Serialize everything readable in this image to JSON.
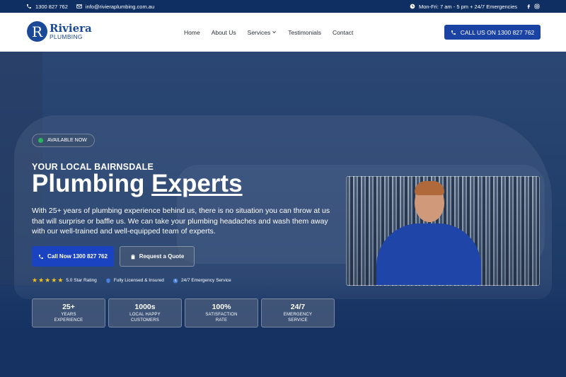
{
  "topbar": {
    "phone": "1300 827 762",
    "email": "info@rivieraplumbing.com.au",
    "hours": "Mon-Fri: 7 am - 5 pm + 24/7 Emergencies"
  },
  "logo": {
    "line1": "Riviera",
    "line2": "PLUMBING",
    "mark": "R"
  },
  "nav": {
    "home": "Home",
    "about": "About Us",
    "services": "Services",
    "testimonials": "Testimonials",
    "contact": "Contact"
  },
  "header": {
    "call_label": "CALL US ON 1300 827 762"
  },
  "hero": {
    "badge": "AVAILABLE NOW",
    "kicker": "YOUR LOCAL BAIRNSDALE",
    "headline_part1": "Plumbing ",
    "headline_part2": "Experts",
    "description": "With 25+ years of plumbing experience behind us, there is no situation you can throw at us that will surprise or baffle us. We can take your plumbing headaches and wash them away with our well-trained and well-equipped team of experts.",
    "call_button": "Call Now 1300 827 762",
    "quote_button": "Request a Quote",
    "rating_text": "5.0 Star Rating",
    "licensed_text": "Fully Licensed & Insured",
    "emergency_text": "24/7 Emergency Service",
    "star_count": 5
  },
  "stats": [
    {
      "value": "25+",
      "line1": "YEARS",
      "line2": "EXPERIENCE"
    },
    {
      "value": "1000s",
      "line1": "LOCAL HAPPY",
      "line2": "CUSTOMERS"
    },
    {
      "value": "100%",
      "line1": "SATISFACTION",
      "line2": "RATE"
    },
    {
      "value": "24/7",
      "line1": "EMERGENCY",
      "line2": "SERVICE"
    }
  ],
  "colors": {
    "brand_blue": "#1a4a97",
    "button_blue": "#1a43c2",
    "topbar_bg": "#0f2f62",
    "star_yellow": "#f5c21a",
    "available_green": "#29b35c"
  },
  "icons": {
    "phone": "phone-icon",
    "email": "envelope-icon",
    "clock": "clock-icon",
    "facebook": "facebook-icon",
    "instagram": "instagram-icon",
    "chevron": "chevron-down-icon",
    "shield": "shield-icon",
    "clipboard": "clipboard-icon",
    "emergency": "clock-icon"
  }
}
